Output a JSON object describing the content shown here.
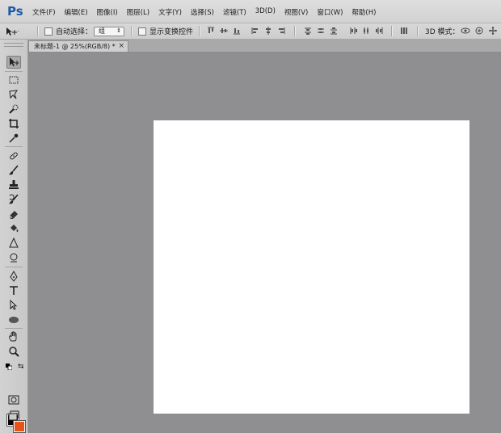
{
  "app": {
    "logo": "Ps"
  },
  "menu": [
    "文件(F)",
    "编辑(E)",
    "图像(I)",
    "图层(L)",
    "文字(Y)",
    "选择(S)",
    "滤镜(T)",
    "3D(D)",
    "视图(V)",
    "窗口(W)",
    "帮助(H)"
  ],
  "options": {
    "auto_select_label": "自动选择：",
    "auto_select_value": "组",
    "show_transform_label": "显示变换控件",
    "mode_3d_label": "3D 模式："
  },
  "document": {
    "tab_title": "未标题-1 @ 25%(RGB/8) *",
    "close_glyph": "×"
  },
  "colors": {
    "foreground": "#000000",
    "background": "#e5541b",
    "workspace": "#8f8e90",
    "canvas": "#ffffff",
    "logo": "#1c5aa8"
  },
  "tools": [
    "move-tool",
    "marquee-tool",
    "lasso-tool",
    "quick-selection-tool",
    "crop-tool",
    "eyedropper-tool",
    "healing-brush-tool",
    "brush-tool",
    "clone-stamp-tool",
    "history-brush-tool",
    "eraser-tool",
    "paint-bucket-tool",
    "blur-tool",
    "dodge-tool",
    "pen-tool",
    "type-tool",
    "path-selection-tool",
    "ellipse-tool",
    "hand-tool",
    "zoom-tool",
    "quick-mask-mode",
    "screen-mode"
  ]
}
